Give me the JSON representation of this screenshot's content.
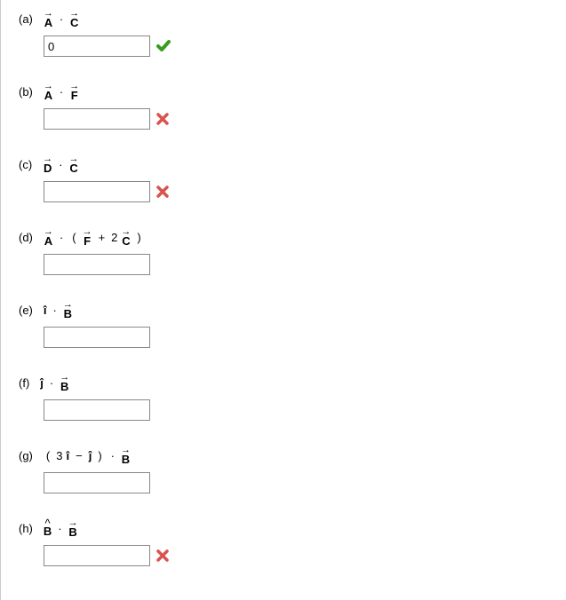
{
  "questions": [
    {
      "label": "(a)",
      "value": "0",
      "feedback": "correct"
    },
    {
      "label": "(b)",
      "value": "",
      "feedback": "incorrect"
    },
    {
      "label": "(c)",
      "value": "",
      "feedback": "incorrect"
    },
    {
      "label": "(d)",
      "value": "",
      "feedback": "none"
    },
    {
      "label": "(e)",
      "value": "",
      "feedback": "none"
    },
    {
      "label": "(f)",
      "value": "",
      "feedback": "none"
    },
    {
      "label": "(g)",
      "value": "",
      "feedback": "none"
    },
    {
      "label": "(h)",
      "value": "",
      "feedback": "incorrect"
    }
  ],
  "expressions": {
    "a": {
      "p1": "A",
      "dot": "·",
      "p2": "C"
    },
    "b": {
      "p1": "A",
      "dot": "·",
      "p2": "F"
    },
    "c": {
      "p1": "D",
      "dot": "·",
      "p2": "C"
    },
    "d": {
      "p1": "A",
      "dot": "·",
      "lp": "(",
      "p2": "F",
      "plus": "+",
      "two": "2",
      "p3": "C",
      "rp": ")"
    },
    "e": {
      "p1": "î",
      "dot": "·",
      "p2": "B"
    },
    "f": {
      "p1": "ĵ",
      "dot": "·",
      "p2": "B"
    },
    "g": {
      "lp": "(",
      "three": "3",
      "p1": "î",
      "minus": "−",
      "p2": "ĵ",
      "rp": ")",
      "dot": "·",
      "p3": "B"
    },
    "h": {
      "p1": "B",
      "dot": "·",
      "p2": "B"
    }
  }
}
